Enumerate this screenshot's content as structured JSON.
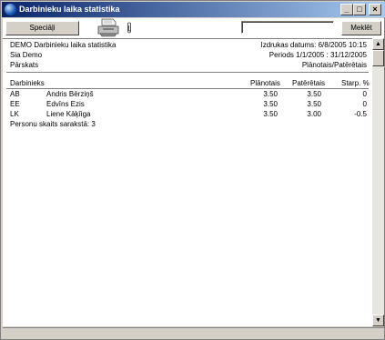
{
  "window": {
    "title": "Darbinieku laika statistika",
    "buttons": {
      "minimize": "_",
      "maximize": "□",
      "close": "×"
    }
  },
  "toolbar": {
    "special_label": "Speciāļi",
    "search_label": "Meklēt",
    "search_value": ""
  },
  "report": {
    "company": "DEMO Darbinieku laika statistika",
    "org": "Sia Demo",
    "overview": "Pārskats",
    "print_date": "Izdrukas datums: 6/8/2005 10:15",
    "period": "Periods  1/1/2005 : 31/12/2005",
    "view": "Plānotais/Patērētais"
  },
  "table": {
    "headers": [
      "Darbinieks",
      "Plānotais",
      "Patērētais",
      "Starp. %"
    ],
    "rows": [
      {
        "code": "AB",
        "name": "Andris Bērziņš",
        "planned": "3.50",
        "used": "3.50",
        "diff": "0"
      },
      {
        "code": "EE",
        "name": "Edvīns Ezis",
        "planned": "3.50",
        "used": "3.50",
        "diff": "0"
      },
      {
        "code": "LK",
        "name": "Liene Kāķīiga",
        "planned": "3.50",
        "used": "3.00",
        "diff": "-0.5"
      }
    ],
    "footer": "Personu skaits sarakstā: 3"
  }
}
